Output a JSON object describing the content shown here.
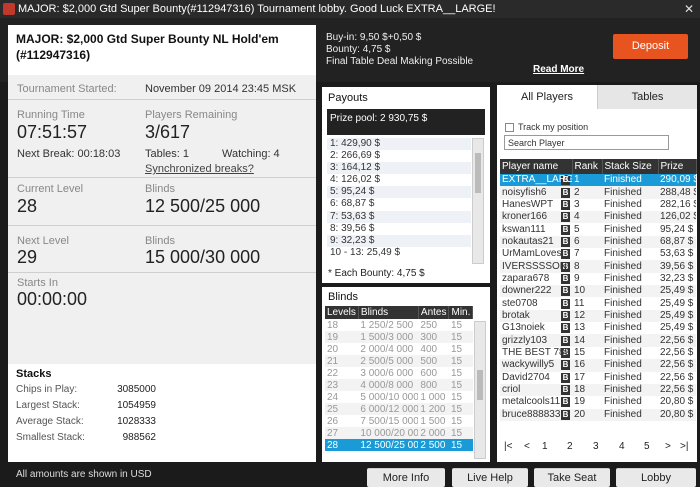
{
  "window": {
    "title": "MAJOR: $2,000 Gtd Super Bounty(#112947316) Tournament lobby. Good Luck EXTRA__LARGE!",
    "close_glyph": "✕"
  },
  "tournament": {
    "name": "MAJOR: $2,000 Gtd Super Bounty NL Hold'em (#112947316)",
    "started_label": "Tournament Started:",
    "started_value": "November 09 2014  23:45 MSK",
    "running_time_label": "Running Time",
    "running_time": "07:51:57",
    "players_remaining_label": "Players Remaining",
    "players_remaining": "3/617",
    "next_break": "Next Break: 00:18:03",
    "tables": "Tables: 1",
    "watching": "Watching: 4",
    "sync_breaks_link": "Synchronized breaks?",
    "current_level_label": "Current Level",
    "current_level": "28",
    "blinds_label": "Blinds",
    "current_blinds": "12 500/25 000",
    "next_level_label": "Next Level",
    "next_level": "29",
    "next_blinds_label": "Blinds",
    "next_blinds": "15 000/30 000",
    "starts_in_label": "Starts In",
    "starts_in": "00:00:00"
  },
  "stacks": {
    "title": "Stacks",
    "rows": [
      {
        "label": "Chips in Play:",
        "value": "3085000"
      },
      {
        "label": "Largest Stack:",
        "value": "1054959"
      },
      {
        "label": "Average Stack:",
        "value": "1028333"
      },
      {
        "label": "Smallest Stack:",
        "value": "988562"
      }
    ]
  },
  "footer_note": "All amounts are shown in USD",
  "buyin": {
    "line1": "Buy-in: 9,50 $+0,50 $",
    "line2": "Bounty: 4,75 $",
    "line3": "Final Table Deal Making Possible",
    "read_more": "Read More",
    "deposit": "Deposit"
  },
  "payouts": {
    "title": "Payouts",
    "prize_pool": "Prize pool: 2 930,75 $",
    "rows": [
      "1: 429,90 $",
      "2: 266,69 $",
      "3: 164,12 $",
      "4: 126,02 $",
      "5: 95,24 $",
      "6: 68,87 $",
      "7: 53,63 $",
      "8: 39,56 $",
      "9: 32,23 $",
      "10 - 13: 25,49 $"
    ],
    "bounty_note": "* Each Bounty: 4,75 $"
  },
  "blinds": {
    "title": "Blinds",
    "headers": [
      "Levels",
      "Blinds",
      "Antes",
      "Min."
    ],
    "rows": [
      [
        "18",
        "1 250/2 500",
        "250",
        "15"
      ],
      [
        "19",
        "1 500/3 000",
        "300",
        "15"
      ],
      [
        "20",
        "2 000/4 000",
        "400",
        "15"
      ],
      [
        "21",
        "2 500/5 000",
        "500",
        "15"
      ],
      [
        "22",
        "3 000/6 000",
        "600",
        "15"
      ],
      [
        "23",
        "4 000/8 000",
        "800",
        "15"
      ],
      [
        "24",
        "5 000/10 000",
        "1 000",
        "15"
      ],
      [
        "25",
        "6 000/12 000",
        "1 200",
        "15"
      ],
      [
        "26",
        "7 500/15 000",
        "1 500",
        "15"
      ],
      [
        "27",
        "10 000/20 000",
        "2 000",
        "15"
      ],
      [
        "28",
        "12 500/25 000",
        "2 500",
        "15"
      ]
    ],
    "active_row": 10
  },
  "players": {
    "tab_all": "All Players",
    "tab_tables": "Tables",
    "track_label": "Track my position",
    "search_value": "Search Player",
    "headers": [
      "Player name",
      "Rank",
      "Stack Size",
      "Prize"
    ],
    "badge": "B",
    "rows": [
      [
        "EXTRA__LARGE",
        "1",
        "Finished",
        "290,09 $"
      ],
      [
        "noisyfish6",
        "2",
        "Finished",
        "288,48 $"
      ],
      [
        "HanesWPT",
        "3",
        "Finished",
        "282,16 $"
      ],
      [
        "kroner166",
        "4",
        "Finished",
        "126,02 $"
      ],
      [
        "kswan111",
        "5",
        "Finished",
        "95,24 $"
      ],
      [
        "nokautas21",
        "6",
        "Finished",
        "68,87 $"
      ],
      [
        "UrMamLoves",
        "7",
        "Finished",
        "53,63 $"
      ],
      [
        "IVERSSSSON",
        "8",
        "Finished",
        "39,56 $"
      ],
      [
        "zapara678",
        "9",
        "Finished",
        "32,23 $"
      ],
      [
        "downer222",
        "10",
        "Finished",
        "25,49 $"
      ],
      [
        "ste0708",
        "11",
        "Finished",
        "25,49 $"
      ],
      [
        "brotak",
        "12",
        "Finished",
        "25,49 $"
      ],
      [
        "G13noiek",
        "13",
        "Finished",
        "25,49 $"
      ],
      [
        "grizzly103",
        "14",
        "Finished",
        "22,56 $"
      ],
      [
        "THE BEST 789",
        "15",
        "Finished",
        "22,56 $"
      ],
      [
        "wackywilly5",
        "16",
        "Finished",
        "22,56 $"
      ],
      [
        "David2704",
        "17",
        "Finished",
        "22,56 $"
      ],
      [
        "criol",
        "18",
        "Finished",
        "22,56 $"
      ],
      [
        "metalcools11",
        "19",
        "Finished",
        "20,80 $"
      ],
      [
        "bruce888833",
        "20",
        "Finished",
        "20,80 $"
      ]
    ],
    "pages": [
      "1",
      "2",
      "3",
      "4",
      "5"
    ],
    "first": "|<",
    "prev": "<",
    "next": ">",
    "last": ">|"
  },
  "buttons": {
    "more_info": "More Info",
    "live_help": "Live Help",
    "take_seat": "Take Seat",
    "lobby": "Lobby"
  },
  "colors": {
    "accent": "#1a9bd7",
    "deposit": "#e8541f",
    "dark_bg": "#1b1b1b"
  }
}
